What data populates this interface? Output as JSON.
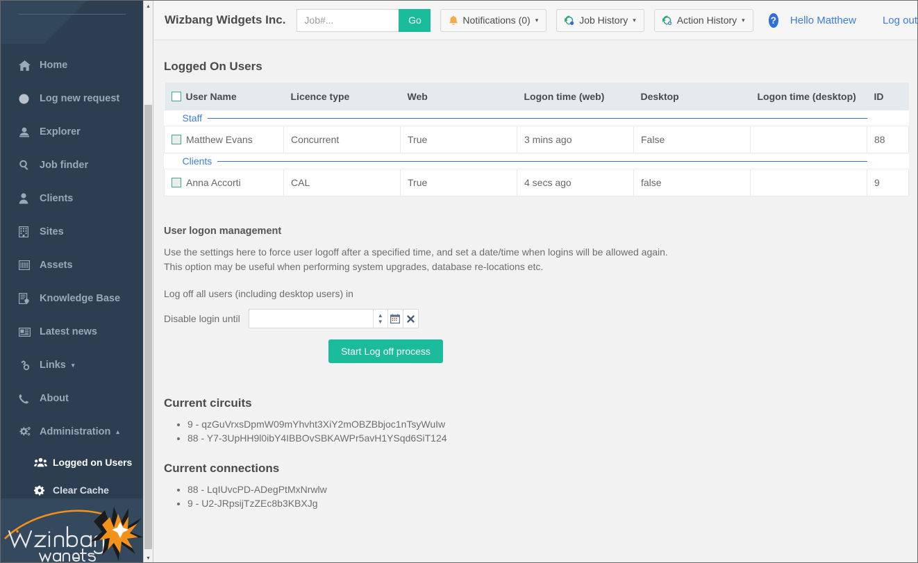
{
  "sidebar": {
    "items": [
      {
        "label": "Home",
        "icon": "home-icon"
      },
      {
        "label": "Log new request",
        "icon": "circle-icon"
      },
      {
        "label": "Explorer",
        "icon": "explorer-icon"
      },
      {
        "label": "Job finder",
        "icon": "search-icon"
      },
      {
        "label": "Clients",
        "icon": "user-icon"
      },
      {
        "label": "Sites",
        "icon": "building-icon"
      },
      {
        "label": "Assets",
        "icon": "assets-icon"
      },
      {
        "label": "Knowledge Base",
        "icon": "book-icon"
      },
      {
        "label": "Latest news",
        "icon": "news-icon"
      },
      {
        "label": "Links",
        "icon": "link-icon",
        "caret": "▾"
      },
      {
        "label": "About",
        "icon": "phone-icon"
      },
      {
        "label": "Administration",
        "icon": "cogs-icon",
        "caret": "▴"
      }
    ],
    "subitems": [
      {
        "label": "Logged on Users",
        "icon": "users-icon"
      },
      {
        "label": "Clear Cache",
        "icon": "gear-icon"
      }
    ],
    "logo": {
      "word1": "Wizbang",
      "word2": "widgets"
    }
  },
  "header": {
    "brand": "Wizbang Widgets Inc.",
    "search_placeholder": "Job#...",
    "search_value": "",
    "go_label": "Go",
    "notifications_label": "Notifications (0)",
    "job_history_label": "Job History",
    "action_history_label": "Action History",
    "help_label": "?",
    "greeting": "Hello Matthew",
    "logout_label": "Log out",
    "caret": "▾"
  },
  "main": {
    "page_title": "Logged On Users",
    "table": {
      "columns": [
        "User Name",
        "Licence type",
        "Web",
        "Logon time (web)",
        "Desktop",
        "Logon time (desktop)",
        "ID"
      ],
      "groups": [
        {
          "label": "Staff",
          "rows": [
            {
              "user": "Matthew Evans",
              "licence": "Concurrent",
              "web": "True",
              "logon_web": "3 mins ago",
              "desktop": "False",
              "logon_desktop": "",
              "id": "88"
            }
          ]
        },
        {
          "label": "Clients",
          "rows": [
            {
              "user": "Anna Accorti",
              "licence": "CAL",
              "web": "True",
              "logon_web": "4 secs ago",
              "desktop": "false",
              "logon_desktop": "",
              "id": "9"
            }
          ]
        }
      ]
    },
    "logon_management": {
      "title": "User logon management",
      "desc_line1": "Use the settings here to force user logoff after a specified time, and set a date/time when logins will be allowed again.",
      "desc_line2": "This option may be useful when performing system upgrades, database re-locations etc.",
      "logoff_line": "Log off all users (including desktop users) in",
      "date_label": "Disable login until",
      "date_value": "",
      "calendar_icon": "calendar-icon",
      "clear_icon": "clear-icon",
      "start_button": "Start Log off process"
    },
    "circuits": {
      "title": "Current circuits",
      "items": [
        "9 - qzGuVrxsDpmW09mYhvht3XiY2mOBZBbjoc1nTsyWuIw",
        "88 - Y7-3UpHH9l0ibY4IBBOvSBKAWPr5avH1YSqd6SiT124"
      ]
    },
    "connections": {
      "title": "Current connections",
      "items": [
        "88 - LqIUvcPD-ADegPtMxNrwlw",
        "9 - U2-JRpsijTzZEc8b3KBXJg"
      ]
    }
  },
  "colors": {
    "sidebar_bg": "#2c3e50",
    "accent_green": "#1abc9c",
    "link_blue": "#3b7ddd",
    "logo_orange": "#f2911b"
  }
}
